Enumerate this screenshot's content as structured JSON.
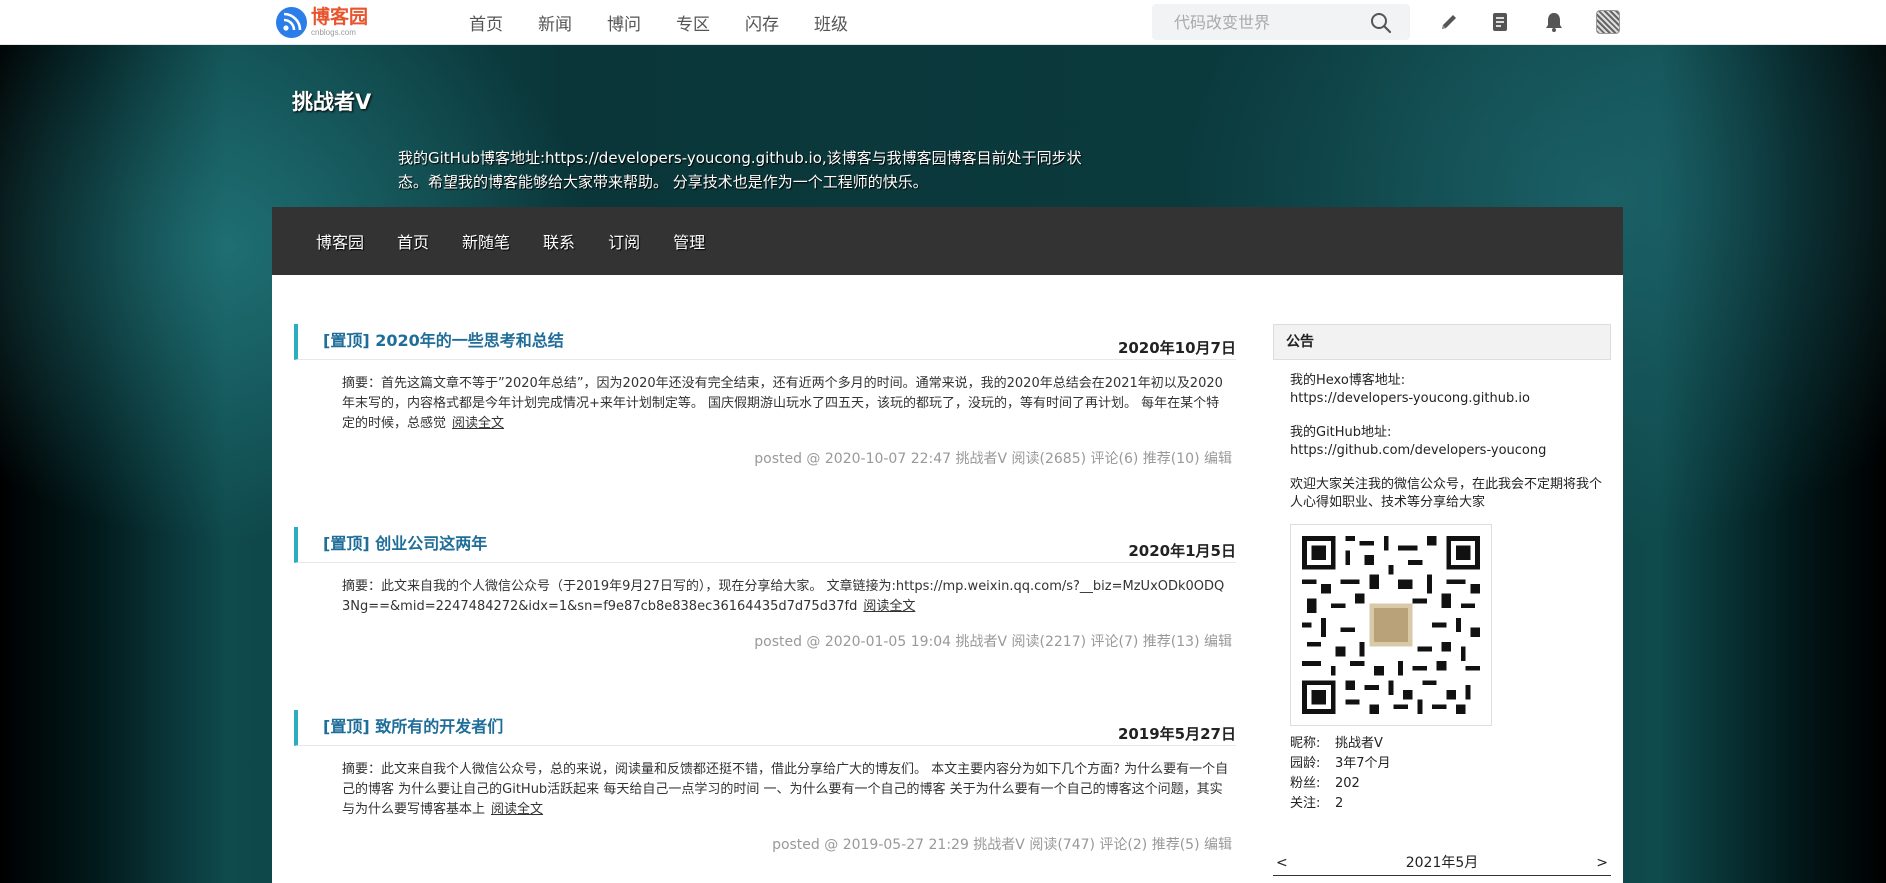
{
  "topbar": {
    "logo_name": "博客园",
    "logo_sub": "cnblogs.com",
    "nav": [
      "首页",
      "新闻",
      "博问",
      "专区",
      "闪存",
      "班级"
    ],
    "search_placeholder": "代码改变世界"
  },
  "header": {
    "title": "挑战者V",
    "description": "我的GitHub博客地址:https://developers-youcong.github.io,该博客与我博客园博客目前处于同步状态。希望我的博客能够给大家带来帮助。 分享技术也是作为一个工程师的快乐。"
  },
  "blog_nav": [
    "博客园",
    "首页",
    "新随笔",
    "联系",
    "订阅",
    "管理"
  ],
  "posts": [
    {
      "title": "[置顶] 2020年的一些思考和总结",
      "date": "2020年10月7日",
      "summary": "摘要：首先这篇文章不等于”2020年总结”，因为2020年还没有完全结束，还有近两个多月的时间。通常来说，我的2020年总结会在2021年初以及2020年末写的，内容格式都是今年计划完成情况+来年计划制定等。 国庆假期游山玩水了四五天，该玩的都玩了，没玩的，等有时间了再计划。 每年在某个特定的时候，总感觉",
      "read_more": "阅读全文",
      "footer": "posted @ 2020-10-07 22:47 挑战者V 阅读(2685) 评论(6) 推荐(10) 编辑"
    },
    {
      "title": "[置顶] 创业公司这两年",
      "date": "2020年1月5日",
      "summary": "摘要：此文来自我的个人微信公众号（于2019年9月27日写的），现在分享给大家。 文章链接为:https://mp.weixin.qq.com/s?__biz=MzUxODk0ODQ3Ng==&mid=2247484272&idx=1&sn=f9e87cb8e838ec36164435d7d75d37fd",
      "read_more": "阅读全文",
      "footer": "posted @ 2020-01-05 19:04 挑战者V 阅读(2217) 评论(7) 推荐(13) 编辑"
    },
    {
      "title": "[置顶] 致所有的开发者们",
      "date": "2019年5月27日",
      "summary": "摘要：此文来自我个人微信公众号，总的来说，阅读量和反馈都还挺不错，借此分享给广大的博友们。 本文主要内容分为如下几个方面? 为什么要有一个自己的博客 为什么要让自己的GitHub活跃起来 每天给自己一点学习的时间 一、为什么要有一个自己的博客 关于为什么要有一个自己的博客这个问题，其实与为什么要写博客基本上",
      "read_more": "阅读全文",
      "footer": "posted @ 2019-05-27 21:29 挑战者V 阅读(747) 评论(2) 推荐(5) 编辑"
    }
  ],
  "sidebar": {
    "heading": "公告",
    "hexo_label": "我的Hexo博客地址:",
    "hexo_url": "https://developers-youcong.github.io",
    "github_label": "我的GitHub地址:",
    "github_url": "https://github.com/developers-youcong",
    "wechat_text": "欢迎大家关注我的微信公众号，在此我会不定期将我个人心得如职业、技术等分享给大家",
    "stats": [
      {
        "k": "昵称:",
        "v": "挑战者V"
      },
      {
        "k": "园龄:",
        "v": "3年7个月"
      },
      {
        "k": "粉丝:",
        "v": "202"
      },
      {
        "k": "关注:",
        "v": "2"
      }
    ],
    "calendar": {
      "prev": "<",
      "month": "2021年5月",
      "next": ">"
    }
  },
  "icons": {
    "edit": "pencil-icon",
    "drafts": "document-icon",
    "notifications": "bell-icon",
    "search": "search-icon"
  }
}
